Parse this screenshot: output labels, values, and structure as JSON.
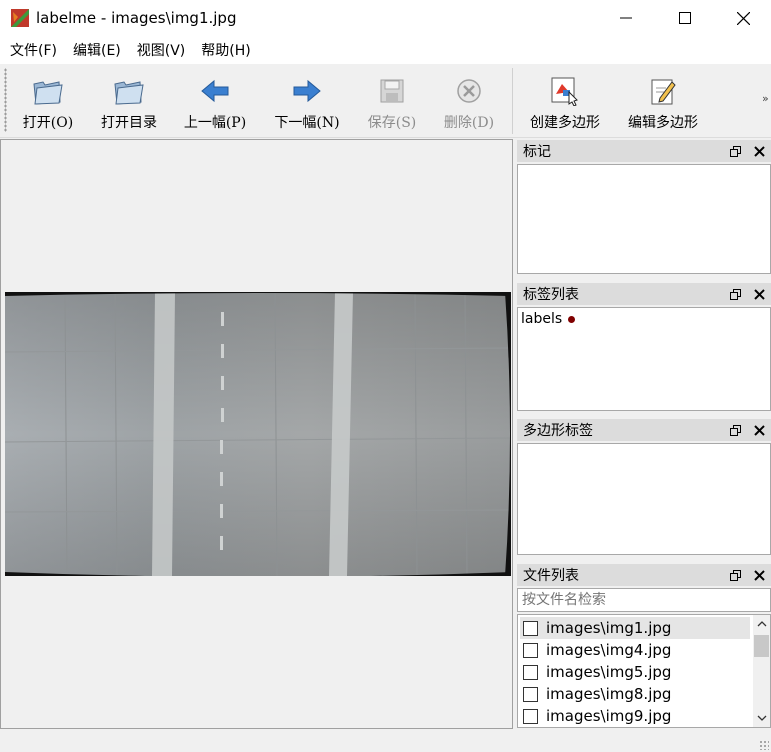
{
  "window": {
    "title": "labelme - images\\img1.jpg"
  },
  "menu": [
    "文件(F)",
    "编辑(E)",
    "视图(V)",
    "帮助(H)"
  ],
  "toolbar": {
    "open": "打开(O)",
    "open_dir": "打开目录",
    "prev": "上一幅(P)",
    "next": "下一幅(N)",
    "save": "保存(S)",
    "delete": "删除(D)",
    "create_polygon": "创建多边形",
    "edit_polygon": "编辑多边形",
    "more": "»"
  },
  "docks": {
    "marks": {
      "title": "标记"
    },
    "label_list": {
      "title": "标签列表",
      "items": [
        {
          "text": "labels",
          "color": "#800000"
        }
      ]
    },
    "polygon_labels": {
      "title": "多边形标签"
    },
    "file_list": {
      "title": "文件列表",
      "search_placeholder": "按文件名检索",
      "files": [
        "images\\img1.jpg",
        "images\\img4.jpg",
        "images\\img5.jpg",
        "images\\img8.jpg",
        "images\\img9.jpg"
      ]
    }
  },
  "colors": {
    "accent_blue": "#3a7fd0",
    "label_dot": "#800000",
    "selection": "#e5e5e5"
  }
}
